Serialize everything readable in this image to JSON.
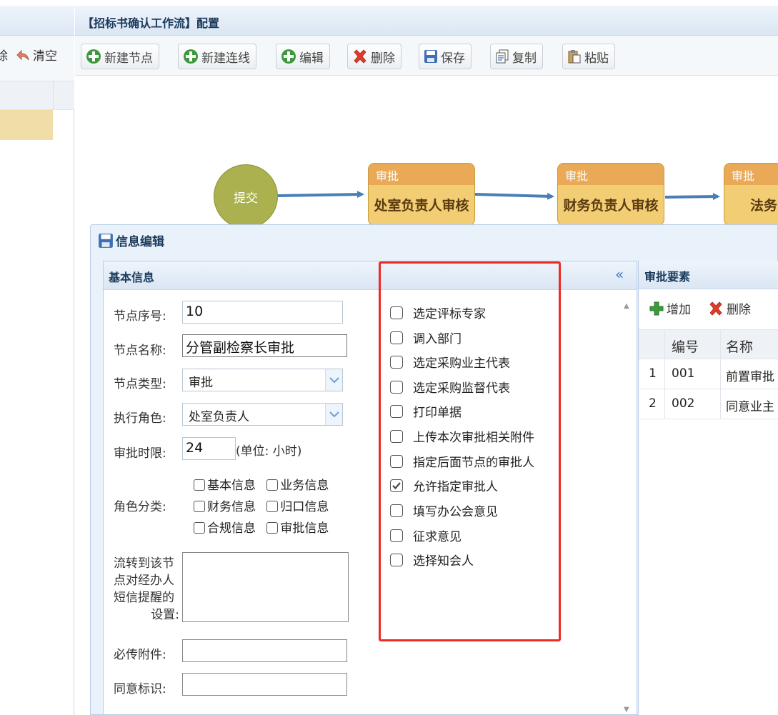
{
  "left_panel": {
    "tool_partial": "除",
    "clear_label": "清空"
  },
  "workflow": {
    "title": "【招标书确认工作流】配置",
    "toolbar": {
      "new_node": "新建节点",
      "new_link": "新建连线",
      "edit": "编辑",
      "delete": "删除",
      "save": "保存",
      "copy": "复制",
      "paste": "粘贴"
    },
    "start_node": "提交",
    "nodes": [
      {
        "type": "审批",
        "name": "处室负责人审核"
      },
      {
        "type": "审批",
        "name": "财务负责人审核"
      },
      {
        "type": "审批",
        "name": "法务"
      }
    ]
  },
  "dialog": {
    "title": "信息编辑",
    "basic": {
      "title": "基本信息",
      "seq_label": "节点序号:",
      "seq_value": "10",
      "name_label": "节点名称:",
      "name_value": "分管副检察长审批",
      "type_label": "节点类型:",
      "type_value": "审批",
      "role_label": "执行角色:",
      "role_value": "处室负责人",
      "limit_label": "审批时限:",
      "limit_value": "24",
      "limit_unit": "(单位: 小时)",
      "category_label": "角色分类:",
      "categories": [
        "基本信息",
        "业务信息",
        "财务信息",
        "归口信息",
        "合规信息",
        "审批信息"
      ],
      "sms_label_lines": [
        "流转到该节",
        "点对经办人",
        "短信提醒的",
        "设置:"
      ],
      "attach_label": "必传附件:",
      "agree_label": "同意标识:"
    },
    "options": [
      {
        "label": "选定评标专家",
        "checked": false
      },
      {
        "label": "调入部门",
        "checked": false
      },
      {
        "label": "选定采购业主代表",
        "checked": false
      },
      {
        "label": "选定采购监督代表",
        "checked": false
      },
      {
        "label": "打印单据",
        "checked": false
      },
      {
        "label": "上传本次审批相关附件",
        "checked": false
      },
      {
        "label": "指定后面节点的审批人",
        "checked": false
      },
      {
        "label": "允许指定审批人",
        "checked": true
      },
      {
        "label": "填写办公会意见",
        "checked": false
      },
      {
        "label": "征求意见",
        "checked": false
      },
      {
        "label": "选择知会人",
        "checked": false
      }
    ],
    "approval": {
      "title": "审批要素",
      "add": "增加",
      "delete": "删除",
      "columns": [
        "编号",
        "名称"
      ],
      "rows": [
        {
          "idx": "1",
          "code": "001",
          "name": "前置审批"
        },
        {
          "idx": "2",
          "code": "002",
          "name": "同意业主"
        }
      ]
    }
  }
}
